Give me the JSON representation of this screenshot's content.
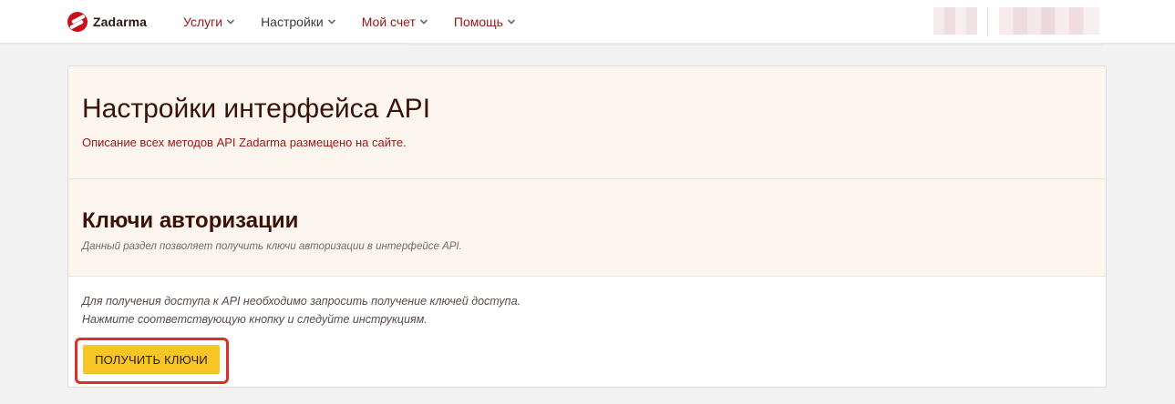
{
  "brand": {
    "name": "Zadarma"
  },
  "nav": {
    "items": [
      {
        "label": "Услуги",
        "style": "red"
      },
      {
        "label": "Настройки",
        "style": "dark"
      },
      {
        "label": "Мой счет",
        "style": "red"
      },
      {
        "label": "Помощь",
        "style": "red"
      }
    ]
  },
  "page": {
    "title": "Настройки интерфейса API",
    "description": "Описание всех методов API Zadarma размещено на сайте."
  },
  "auth_keys": {
    "title": "Ключи авторизации",
    "description": "Данный раздел позволяет получить ключи авторизации в интерфейсе API.",
    "instructions_line1": "Для получения доступа к API необходимо запросить получение ключей доступа.",
    "instructions_line2": "Нажмите соответствующую кнопку и следуйте инструкциям.",
    "button_label": "ПОЛУЧИТЬ КЛЮЧИ"
  },
  "colors": {
    "brand_red": "#c8101c",
    "nav_red": "#9c1414",
    "button_yellow": "#f7c626",
    "highlight_red": "#d9302c",
    "section_bg": "#fcf6ee"
  },
  "icons": {
    "logo": "zadarma-logo-icon",
    "nav_dropdown": "chevron-down-icon"
  }
}
